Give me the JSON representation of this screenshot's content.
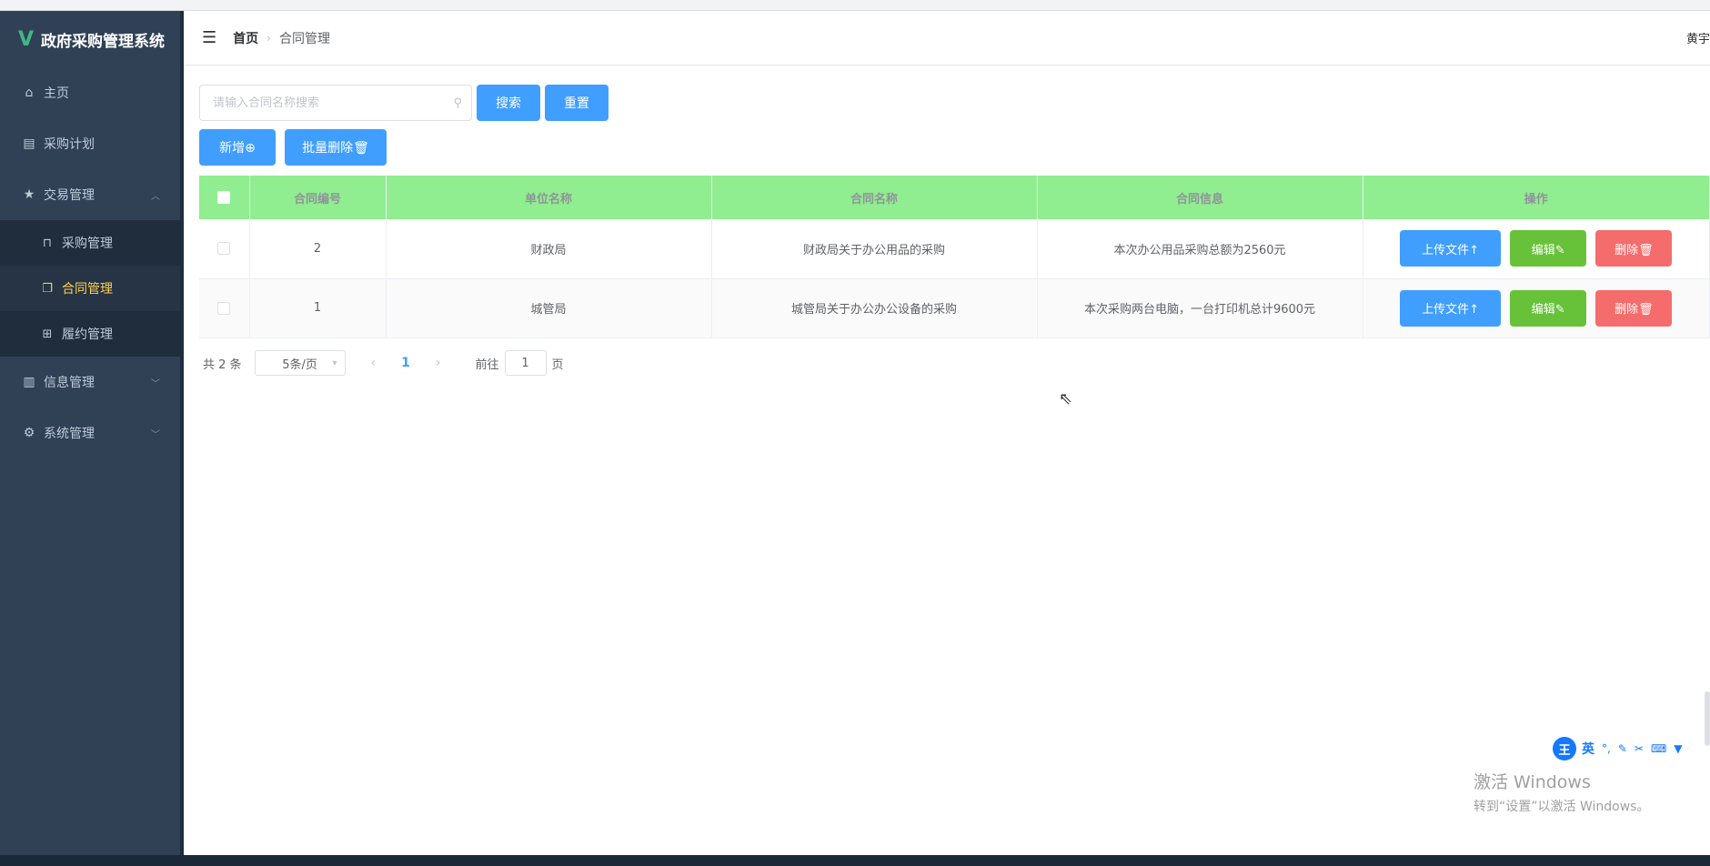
{
  "app": {
    "title": "政府采购管理系统",
    "logo_letter": "V"
  },
  "sidebar": {
    "items": [
      {
        "label": "主页",
        "icon": "home-icon"
      },
      {
        "label": "采购计划",
        "icon": "document-icon"
      },
      {
        "label": "交易管理",
        "icon": "star-icon",
        "expanded": true
      },
      {
        "label": "信息管理",
        "icon": "bar-chart-icon"
      },
      {
        "label": "系统管理",
        "icon": "gear-icon"
      }
    ],
    "sub_items": [
      {
        "label": "采购管理",
        "icon": "bag-icon"
      },
      {
        "label": "合同管理",
        "icon": "copy-document-icon",
        "active": true
      },
      {
        "label": "履约管理",
        "icon": "cart-icon"
      }
    ]
  },
  "header": {
    "breadcrumb_home": "首页",
    "breadcrumb_current": "合同管理",
    "user": "黄宇"
  },
  "search": {
    "placeholder": "请输入合同名称搜索",
    "value": "",
    "search_label": "搜索",
    "reset_label": "重置"
  },
  "toolbar": {
    "add_label": "新增⊕",
    "batch_delete_label": "批量删除🗑"
  },
  "table": {
    "columns": [
      "合同编号",
      "单位名称",
      "合同名称",
      "合同信息",
      "操作"
    ],
    "rows": [
      {
        "id": "2",
        "unit": "财政局",
        "name": "财政局关于办公用品的采购",
        "info": "本次办公用品采购总额为2560元"
      },
      {
        "id": "1",
        "unit": "城管局",
        "name": "城管局关于办公办公设备的采购",
        "info": "本次采购两台电脑，一台打印机总计9600元"
      }
    ],
    "row_actions": {
      "upload": "上传文件↑",
      "edit": "编辑✎",
      "delete": "删除🗑"
    }
  },
  "pagination": {
    "total_text": "共 2 条",
    "page_size": "5条/页",
    "current_page": "1",
    "goto_prefix": "前往",
    "goto_value": "1",
    "goto_suffix": "页"
  },
  "ime": {
    "logo": "王",
    "mode": "英"
  },
  "watermark": {
    "line1": "激活 Windows",
    "line2": "转到“设置”以激活 Windows。"
  },
  "colors": {
    "sidebar_bg": "#304156",
    "active_menu": "#ffd04b",
    "primary": "#409eff",
    "success": "#67c23a",
    "danger": "#f56c6c",
    "table_header": "#90ee90"
  }
}
